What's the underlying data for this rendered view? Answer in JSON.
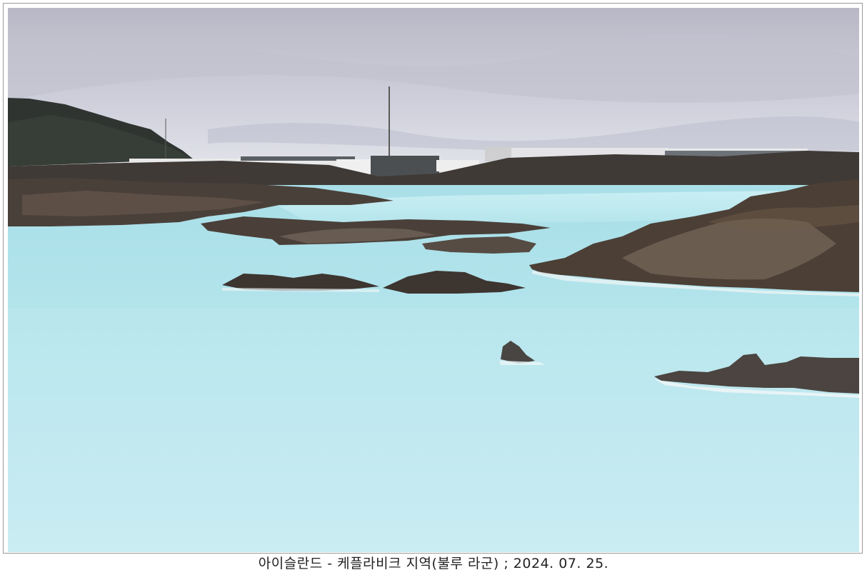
{
  "photo": {
    "subject": "lagoon-landscape",
    "colors": {
      "sky": "#cfd0dc",
      "water": "#bfe6ee",
      "lava_rock": "#4b423c",
      "hill": "#2f3431",
      "building": "#e6e6e6"
    }
  },
  "caption": {
    "text": "아이슬란드 - 케플라비크 지역(불루 라군) ; 2024. 07. 25."
  }
}
